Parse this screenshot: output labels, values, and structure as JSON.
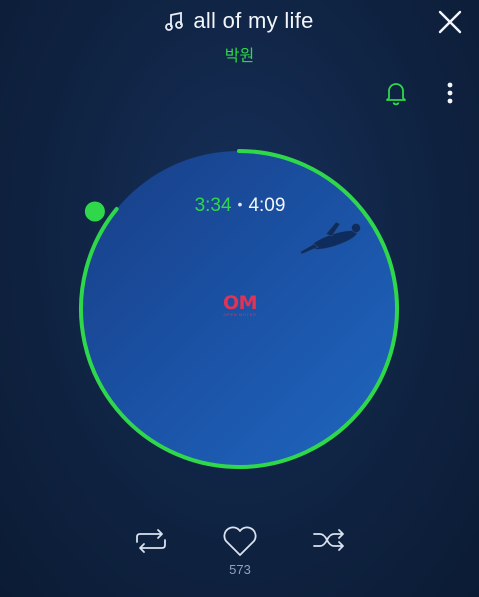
{
  "track": {
    "title": "all of my life",
    "artist": "박원"
  },
  "player": {
    "elapsed": "3:34",
    "separator": "•",
    "total": "4:09",
    "progress_fraction": 0.859,
    "album_logo": "OM",
    "album_logo_sub": "OPEN MOTER",
    "like_count": "573"
  },
  "icons": {
    "title": "music-note-icon",
    "close": "close-icon",
    "notify": "bell-icon",
    "more": "more-vertical-icon",
    "repeat": "repeat-icon",
    "like": "heart-icon",
    "shuffle": "shuffle-icon"
  },
  "colors": {
    "accent": "#2fd84a",
    "background": "#0f2342",
    "logo": "#e23355"
  }
}
